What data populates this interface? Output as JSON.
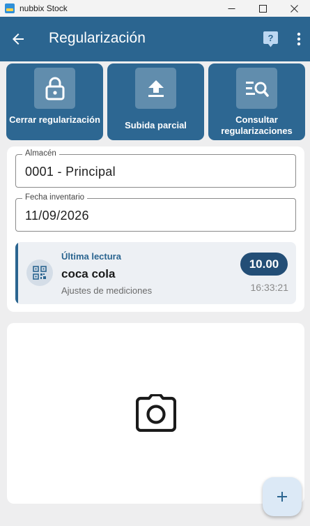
{
  "window": {
    "title": "nubbix Stock",
    "controls": [
      "minimize-icon",
      "maximize-icon",
      "close-icon"
    ]
  },
  "appbar": {
    "title": "Regularización",
    "color": "#2b6590",
    "icons": [
      "arrow-left-icon",
      "help-icon",
      "more-vert-icon"
    ]
  },
  "actions": [
    {
      "label": "Cerrar regularización",
      "icon": "lock-icon"
    },
    {
      "label": "Subida parcial",
      "icon": "upload-icon"
    },
    {
      "label": "Consultar regularizaciones",
      "icon": "search-list-icon"
    }
  ],
  "form": {
    "almacen": {
      "label": "Almacén",
      "value": "0001 - Principal"
    },
    "fecha": {
      "label": "Fecha inventario",
      "value": "11/09/2026"
    }
  },
  "ultima_lectura": {
    "heading": "Última lectura",
    "product": "coca cola",
    "subtitle": "Ajustes de mediciones",
    "quantity": "10.00",
    "time": "16:33:21",
    "icon": "qr-code-icon"
  },
  "photo": {
    "icon": "camera-icon"
  },
  "fab": {
    "icon": "plus-icon"
  }
}
